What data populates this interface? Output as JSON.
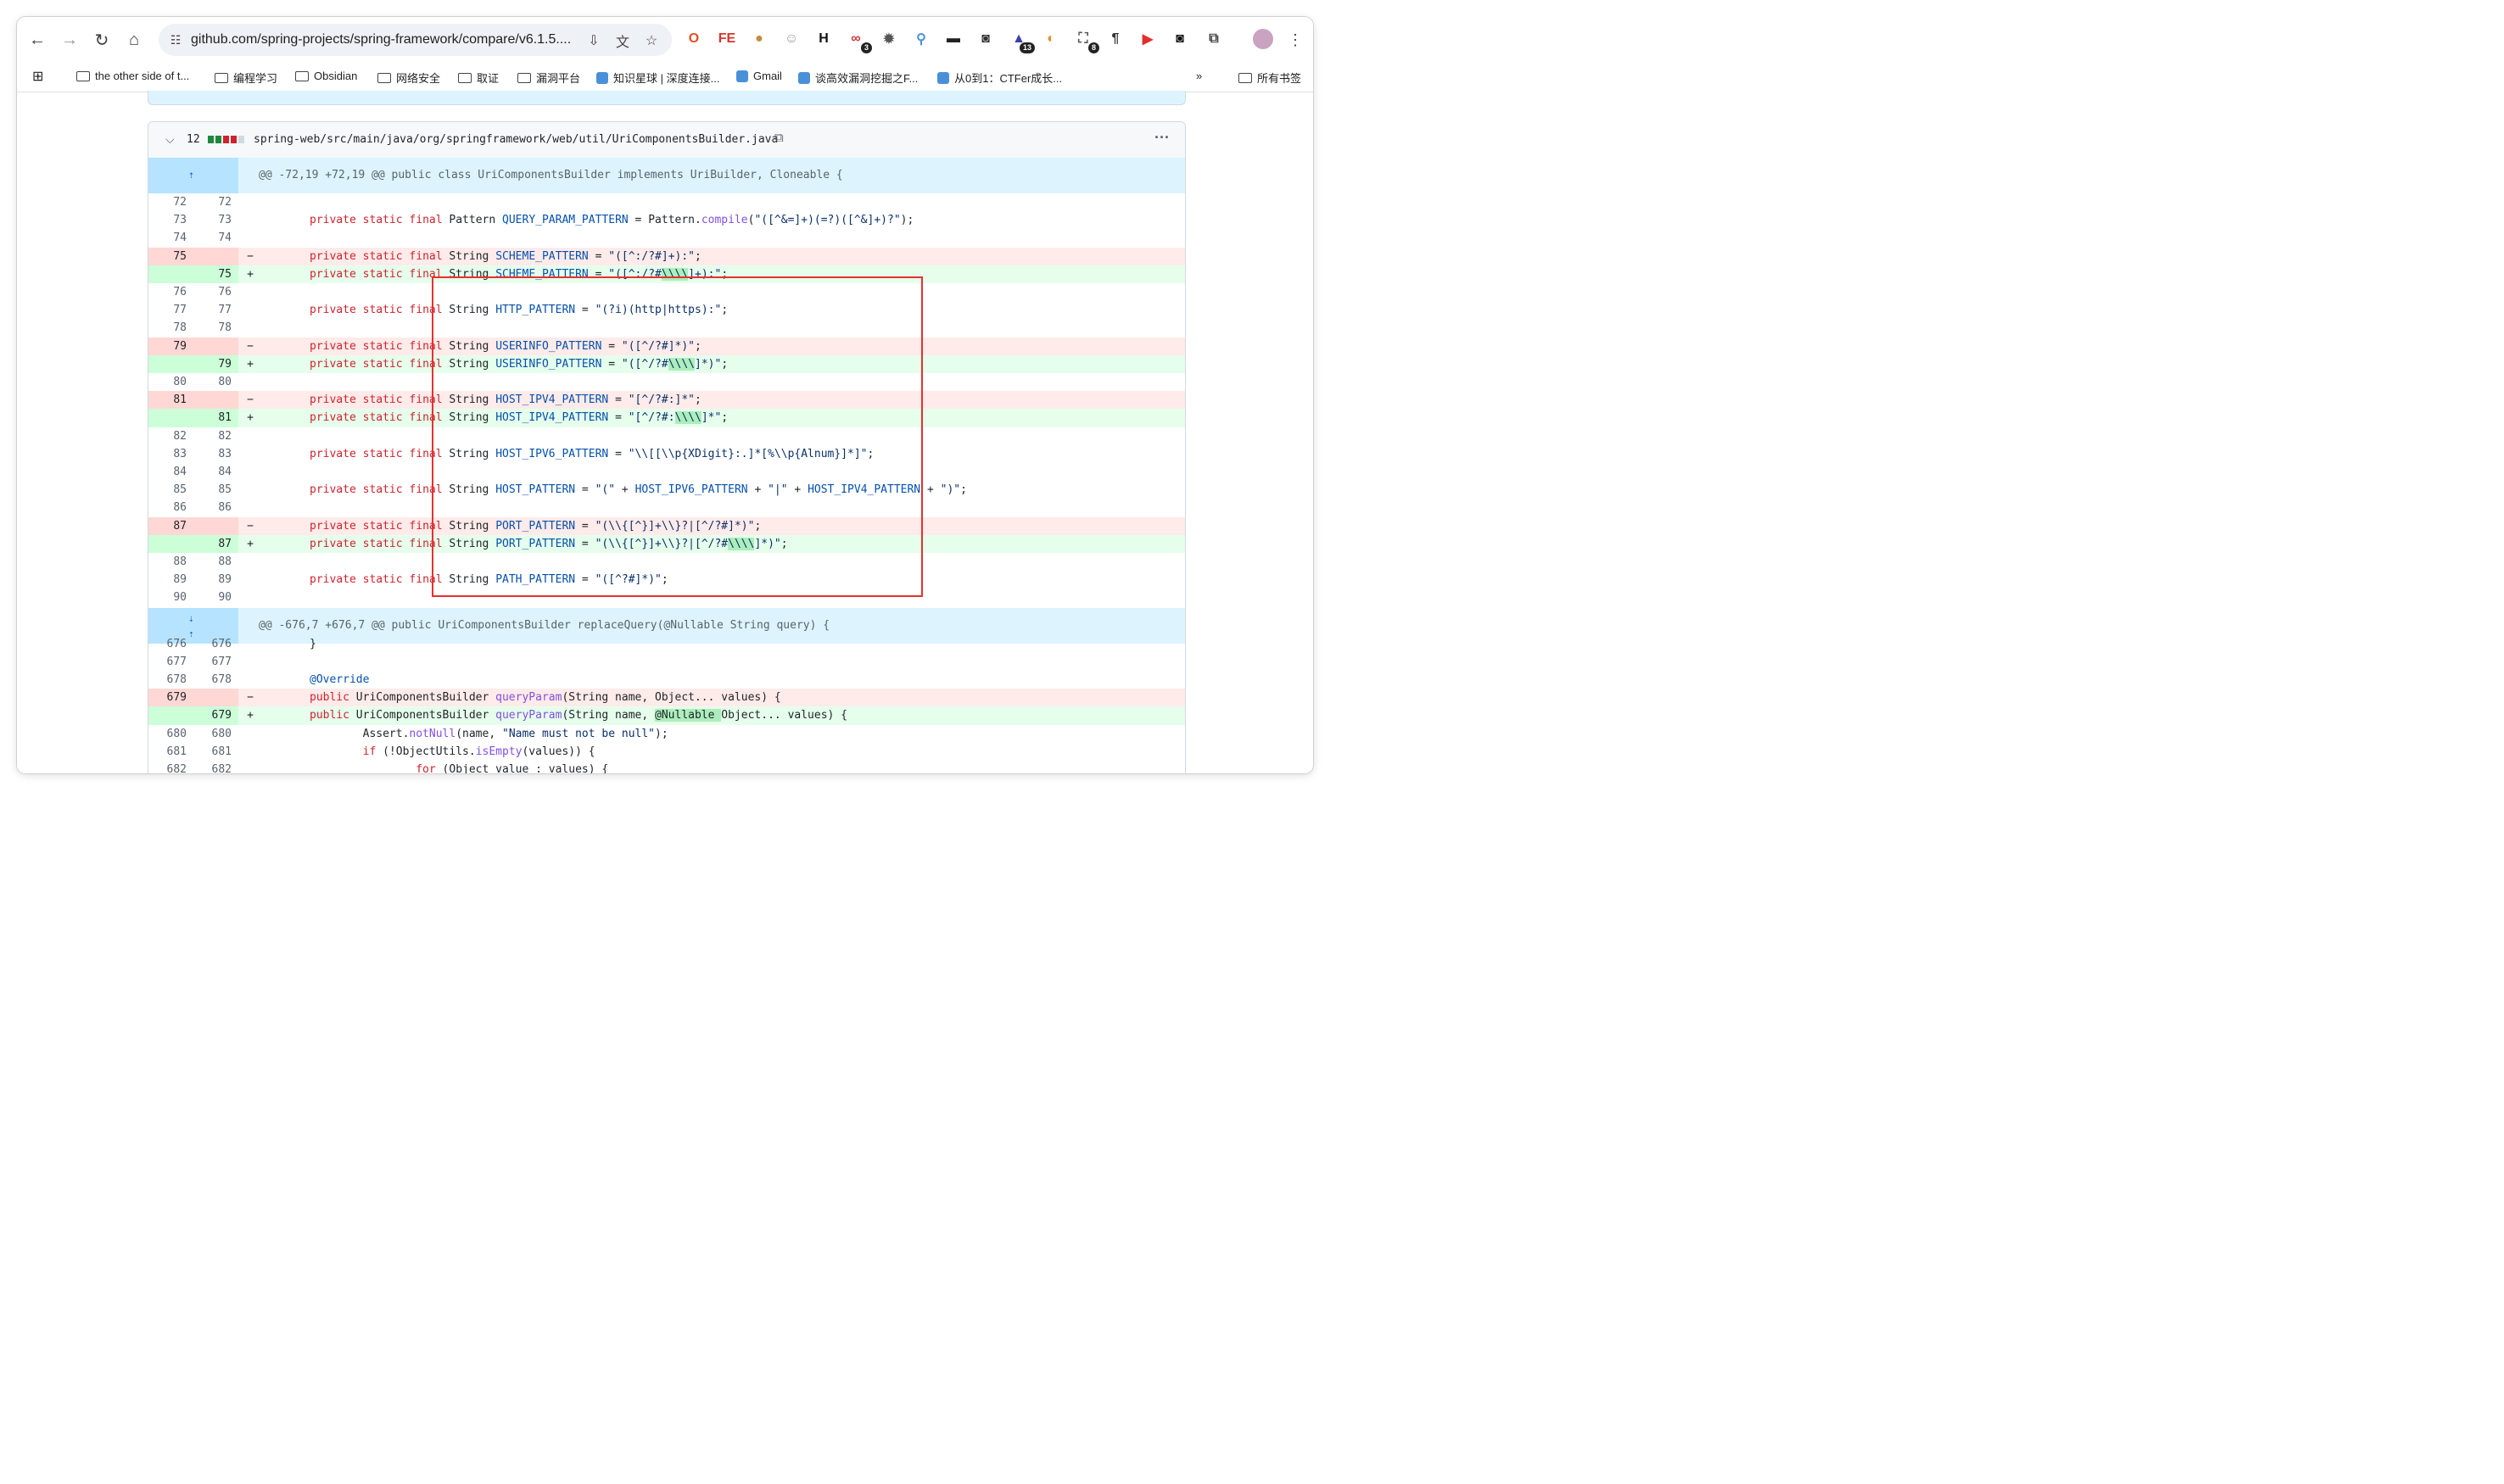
{
  "browser": {
    "url": "github.com/spring-projects/spring-framework/compare/v6.1.5....",
    "extensions": [
      {
        "name": "opera-o-icon",
        "color": "#e34e26",
        "glyph": "O"
      },
      {
        "name": "fe-icon",
        "color": "#d9352a",
        "glyph": "FE"
      },
      {
        "name": "cookie-icon",
        "color": "#c58b3a",
        "glyph": "●"
      },
      {
        "name": "ghost-icon",
        "color": "#9a9a9a",
        "glyph": "☺"
      },
      {
        "name": "h-icon",
        "color": "#111111",
        "glyph": "H"
      },
      {
        "name": "link-icon",
        "color": "#c23a3a",
        "glyph": "∞",
        "badge": "3"
      },
      {
        "name": "gear-ext-icon",
        "color": "#555555",
        "glyph": "✹"
      },
      {
        "name": "pin-icon",
        "color": "#4a90d9",
        "glyph": "⚲"
      },
      {
        "name": "hat-icon",
        "color": "#222222",
        "glyph": "▬"
      },
      {
        "name": "mask-icon",
        "color": "#333333",
        "glyph": "◙"
      },
      {
        "name": "grad-cap-icon",
        "color": "#3b3fa8",
        "glyph": "▲",
        "badge": "13"
      },
      {
        "name": "orange-circle-icon",
        "color": "#f08a24",
        "glyph": "◐"
      },
      {
        "name": "crop-icon",
        "color": "#555555",
        "glyph": "⛶",
        "badge": "8"
      },
      {
        "name": "pilcrow-icon",
        "color": "#333333",
        "glyph": "¶"
      },
      {
        "name": "youtube-icon",
        "color": "#e52d27",
        "glyph": "▶"
      },
      {
        "name": "glasses-icon",
        "color": "#111111",
        "glyph": "◙"
      },
      {
        "name": "puzzle-icon",
        "color": "#444444",
        "glyph": "⧉"
      }
    ],
    "bookmarks": [
      {
        "label": "the other side of t...",
        "type": "folder"
      },
      {
        "label": "编程学习",
        "type": "folder"
      },
      {
        "label": "Obsidian",
        "type": "folder"
      },
      {
        "label": "网络安全",
        "type": "folder"
      },
      {
        "label": "取证",
        "type": "folder"
      },
      {
        "label": "漏洞平台",
        "type": "folder"
      },
      {
        "label": "知识星球 | 深度连接...",
        "type": "site"
      },
      {
        "label": "Gmail",
        "type": "site"
      },
      {
        "label": "谈高效漏洞挖掘之F...",
        "type": "site"
      },
      {
        "label": "从0到1：CTFer成长...",
        "type": "site"
      }
    ],
    "overflow_label": "»",
    "all_bookmarks_label": "所有书签"
  },
  "diff": {
    "changes_count": "12",
    "file_path": "spring-web/src/main/java/org/springframework/web/util/UriComponentsBuilder.java",
    "more_label": "···",
    "hunk1": "@@ -72,19 +72,19 @@ public class UriComponentsBuilder implements UriBuilder, Cloneable {",
    "hunk2": "@@ -676,7 +676,7 @@ public UriComponentsBuilder replaceQuery(@Nullable String query) {",
    "colors": {
      "deleted": "#ffebe9",
      "added": "#e6ffec",
      "hunk": "#ddf4ff",
      "highlight_box": "#e5312f"
    },
    "lines": [
      {
        "t": "ctx",
        "l": "72",
        "r": "72",
        "code": ""
      },
      {
        "t": "ctx",
        "l": "73",
        "r": "73",
        "code": "private static final Pattern QUERY_PARAM_PATTERN = Pattern.compile(\"([^&=]+)(=?)([^&]+)?\");"
      },
      {
        "t": "ctx",
        "l": "74",
        "r": "74",
        "code": ""
      },
      {
        "t": "del",
        "l": "75",
        "r": "",
        "code": "private static final String SCHEME_PATTERN = \"([^:/?#]+):\";"
      },
      {
        "t": "add",
        "l": "",
        "r": "75",
        "code": "private static final String SCHEME_PATTERN = \"([^:/?#\\\\\\\\]+):\";"
      },
      {
        "t": "ctx",
        "l": "76",
        "r": "76",
        "code": ""
      },
      {
        "t": "ctx",
        "l": "77",
        "r": "77",
        "code": "private static final String HTTP_PATTERN = \"(?i)(http|https):\";"
      },
      {
        "t": "ctx",
        "l": "78",
        "r": "78",
        "code": ""
      },
      {
        "t": "del",
        "l": "79",
        "r": "",
        "code": "private static final String USERINFO_PATTERN = \"([^/?#]*)\";"
      },
      {
        "t": "add",
        "l": "",
        "r": "79",
        "code": "private static final String USERINFO_PATTERN = \"([^/?#\\\\\\\\]*)\";"
      },
      {
        "t": "ctx",
        "l": "80",
        "r": "80",
        "code": ""
      },
      {
        "t": "del",
        "l": "81",
        "r": "",
        "code": "private static final String HOST_IPV4_PATTERN = \"[^/?#:]*\";"
      },
      {
        "t": "add",
        "l": "",
        "r": "81",
        "code": "private static final String HOST_IPV4_PATTERN = \"[^/?#:\\\\\\\\]*\";"
      },
      {
        "t": "ctx",
        "l": "82",
        "r": "82",
        "code": ""
      },
      {
        "t": "ctx",
        "l": "83",
        "r": "83",
        "code": "private static final String HOST_IPV6_PATTERN = \"\\\\[[\\\\p{XDigit}:.]*[%\\\\p{Alnum}]*]\";"
      },
      {
        "t": "ctx",
        "l": "84",
        "r": "84",
        "code": ""
      },
      {
        "t": "ctx",
        "l": "85",
        "r": "85",
        "code": "private static final String HOST_PATTERN = \"(\" + HOST_IPV6_PATTERN + \"|\" + HOST_IPV4_PATTERN + \")\";"
      },
      {
        "t": "ctx",
        "l": "86",
        "r": "86",
        "code": ""
      },
      {
        "t": "del",
        "l": "87",
        "r": "",
        "code": "private static final String PORT_PATTERN = \"(\\\\{[^}]+\\\\}?|[^/?#]*)\";"
      },
      {
        "t": "add",
        "l": "",
        "r": "87",
        "code": "private static final String PORT_PATTERN = \"(\\\\{[^}]+\\\\}?|[^/?#\\\\\\\\]*)\";"
      },
      {
        "t": "ctx",
        "l": "88",
        "r": "88",
        "code": ""
      },
      {
        "t": "ctx",
        "l": "89",
        "r": "89",
        "code": "private static final String PATH_PATTERN = \"([^?#]*)\";"
      },
      {
        "t": "ctx",
        "l": "90",
        "r": "90",
        "code": ""
      }
    ],
    "lines2": [
      {
        "t": "ctx",
        "l": "676",
        "r": "676",
        "code": "}"
      },
      {
        "t": "ctx",
        "l": "677",
        "r": "677",
        "code": ""
      },
      {
        "t": "ctx",
        "l": "678",
        "r": "678",
        "code": "@Override"
      },
      {
        "t": "del",
        "l": "679",
        "r": "",
        "code": "public UriComponentsBuilder queryParam(String name, Object... values) {"
      },
      {
        "t": "add",
        "l": "",
        "r": "679",
        "code": "public UriComponentsBuilder queryParam(String name, @Nullable Object... values) {"
      },
      {
        "t": "ctx",
        "l": "680",
        "r": "680",
        "code": "        Assert.notNull(name, \"Name must not be null\");"
      },
      {
        "t": "ctx",
        "l": "681",
        "r": "681",
        "code": "        if (!ObjectUtils.isEmpty(values)) {"
      },
      {
        "t": "ctx",
        "l": "682",
        "r": "682",
        "code": "                for (Object value : values) {"
      }
    ]
  }
}
